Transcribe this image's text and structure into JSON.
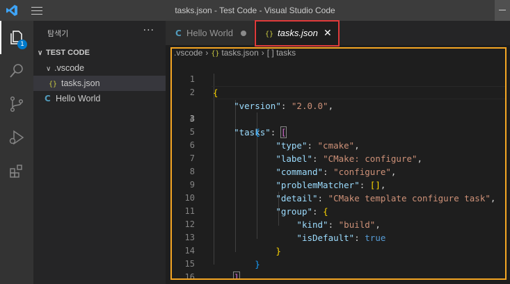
{
  "window": {
    "title": "tasks.json - Test Code - Visual Studio Code"
  },
  "activity_bar": {
    "explorer_badge": "1",
    "items": [
      "explorer-icon",
      "search-icon",
      "source-control-icon",
      "run-debug-icon",
      "extensions-icon"
    ]
  },
  "sidebar": {
    "title": "탐색기",
    "more": "···",
    "root": "TEST CODE",
    "folder": ".vscode",
    "json_icon": "{}",
    "file_json": "tasks.json",
    "c_icon": "C",
    "file_c": "Hello World"
  },
  "tabs": [
    {
      "icon": "C",
      "label": "Hello World",
      "modified": true
    },
    {
      "icon": "{}",
      "label": "tasks.json",
      "close": "✕",
      "active": true
    }
  ],
  "breadcrumb": {
    "folder": ".vscode",
    "json_icon": "{}",
    "file": "tasks.json",
    "symbol": "[ ] tasks",
    "sep": "›"
  },
  "editor": {
    "line_numbers": [
      "1",
      "2",
      "3",
      "4",
      "5",
      "6",
      "7",
      "8",
      "9",
      "10",
      "11",
      "12",
      "13",
      "14",
      "15",
      "16"
    ],
    "current_line": 3,
    "code": {
      "open_root": "{",
      "version_key": "\"version\"",
      "version_val": "\"2.0.0\"",
      "tasks_key": "\"tasks\"",
      "open_arr": "[",
      "open_obj": "{",
      "type_key": "\"type\"",
      "type_val": "\"cmake\"",
      "label_key": "\"label\"",
      "label_val": "\"CMake: configure\"",
      "command_key": "\"command\"",
      "command_val": "\"configure\"",
      "pm_key": "\"problemMatcher\"",
      "pm_val": "[]",
      "detail_key": "\"detail\"",
      "detail_val": "\"CMake template configure task\"",
      "group_key": "\"group\"",
      "kind_key": "\"kind\"",
      "kind_val": "\"build\"",
      "isdefault_key": "\"isDefault\"",
      "isdefault_val": "true",
      "close_group": "}",
      "close_obj": "}",
      "close_arr": "]",
      "close_root": "}"
    }
  },
  "colors": {
    "activity_badge": "#007acc",
    "tab_highlight": "#e03a3a",
    "editor_highlight": "#f5a623"
  }
}
